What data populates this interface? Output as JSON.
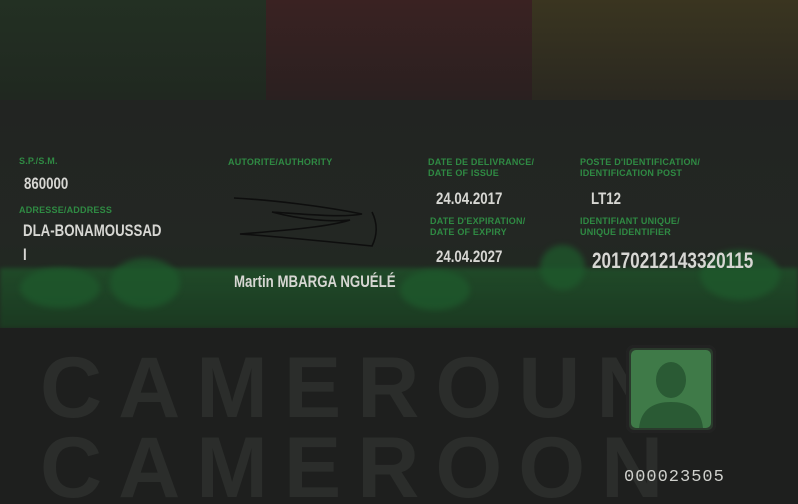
{
  "fields": {
    "spsm_label": "S.P./S.M.",
    "spsm_value": "860000",
    "address_label": "ADRESSE/ADDRESS",
    "address_line1": "DLA-BONAMOUSSAD",
    "address_line2": "I",
    "authority_label": "AUTORITE/AUTHORITY",
    "authority_name": "Martin MBARGA NGUÉLÉ",
    "issue_label_1": "DATE DE DELIVRANCE/",
    "issue_label_2": "DATE OF ISSUE",
    "issue_date": "24.04.2017",
    "expiry_label_1": "DATE D'EXPIRATION/",
    "expiry_label_2": "DATE OF EXPIRY",
    "expiry_date": "24.04.2027",
    "post_label_1": "POSTE D'IDENTIFICATION/",
    "post_label_2": "IDENTIFICATION POST",
    "post_value": "LT12",
    "uid_label_1": "IDENTIFIANT UNIQUE/",
    "uid_label_2": "UNIQUE IDENTIFIER",
    "uid_value": "20170212143320115"
  },
  "background_text": {
    "line1": "CAMEROUN",
    "line2": "CAMEROON"
  },
  "card_number": "000023505",
  "icons": {
    "signature": "signature-icon",
    "photo": "ghost-photo-icon"
  },
  "colors": {
    "label_green": "#2f8a43",
    "flag_green": "#233023",
    "flag_red": "#3a2222",
    "flag_yellow": "#3a3520"
  }
}
